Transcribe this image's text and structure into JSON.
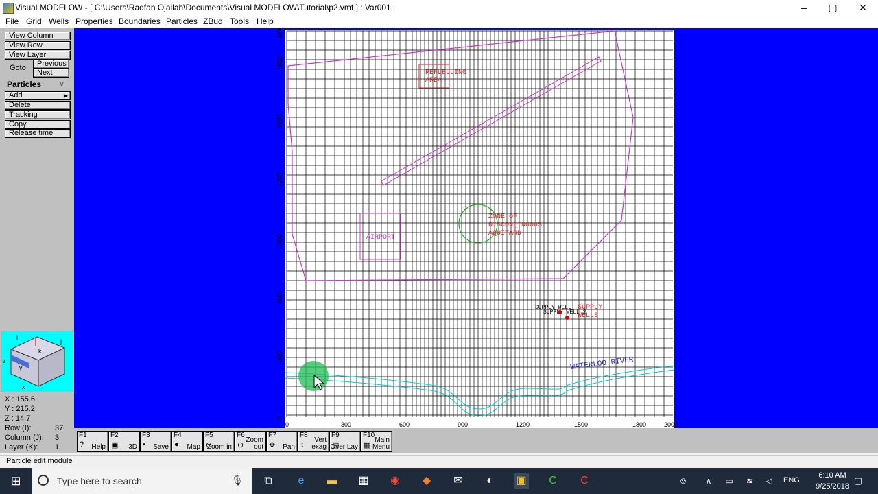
{
  "window": {
    "title": "Visual MODFLOW - [ C:\\Users\\Radfan Ojailah\\Documents\\Visual MODFLOW\\Tutorial\\p2.vmf ] : Var001",
    "minimize": "–",
    "restore": "▢",
    "close": "✕"
  },
  "menu": [
    "File",
    "Grid",
    "Wells",
    "Properties",
    "Boundaries",
    "Particles",
    "ZBud",
    "Tools",
    "Help"
  ],
  "left_panel": {
    "view_column": "View Column",
    "view_row": "View Row",
    "view_layer": "View Layer",
    "goto": "Goto",
    "previous": "Previous",
    "next": "Next",
    "section": "Particles",
    "section_chevron": "∨",
    "add": "Add",
    "add_arrow": "▶",
    "delete": "Delete",
    "tracking": "Tracking",
    "copy": "Copy",
    "release_time": "Release time",
    "cube_axes": {
      "i": "i",
      "j": "j",
      "k": "k",
      "z": "z",
      "y": "y",
      "x": "x"
    }
  },
  "coords": {
    "x_label": "X :",
    "x": "155.6",
    "y_label": "Y :",
    "y": "215.2",
    "z_label": "Z :",
    "z": "14.7",
    "row_label": "Row   (I):",
    "row": "37",
    "col_label": "Column (J):",
    "col": "3",
    "layer_label": "Layer  (K):",
    "layer": "1"
  },
  "map": {
    "x_ticks": [
      "0",
      "300",
      "600",
      "900",
      "1200",
      "1500",
      "1800",
      "2000"
    ],
    "y_ticks": [
      "0",
      "300",
      "600",
      "900",
      "1200",
      "1500",
      "1800",
      "2000"
    ],
    "labels": {
      "refuelling_1": "REFUELLING",
      "refuelling_2": "AREA",
      "zone_1": "ZONE OF",
      "zone_2": "DISCONTINUOUS",
      "zone_3": "AQUITARD",
      "airport": "AIRPORT",
      "supply_well_1": "SUPPLY WELL",
      "supply_well_2": "SUPPLY WELL 2",
      "supply_1": "SUPPLY",
      "supply_2": "WELLS",
      "river": "WATERLOO RIVER"
    },
    "colors": {
      "background": "#0000ff",
      "grid": "#000000",
      "boundary": "#cc33cc",
      "labels": "#dd2222",
      "zone": "#22aa22",
      "river": "#00cccc",
      "river_label": "#2222cc"
    }
  },
  "fkeys": [
    {
      "key": "F1",
      "label": "Help",
      "icon": "question-icon",
      "glyph": "?"
    },
    {
      "key": "F2",
      "label": "3D",
      "icon": "3d-icon",
      "glyph": "▣"
    },
    {
      "key": "F3",
      "label": "Save",
      "icon": "floppy-icon",
      "glyph": "▪"
    },
    {
      "key": "F4",
      "label": "Map",
      "icon": "globe-icon",
      "glyph": "●"
    },
    {
      "key": "F5",
      "label": "Zoom in",
      "icon": "zoom-in-icon",
      "glyph": "⊕"
    },
    {
      "key": "F6",
      "label": "Zoom out",
      "icon": "zoom-out-icon",
      "glyph": "⊖"
    },
    {
      "key": "F7",
      "label": "Pan",
      "icon": "pan-icon",
      "glyph": "✥"
    },
    {
      "key": "F8",
      "label": "Vert exag",
      "icon": "vert-exag-icon",
      "glyph": "↕"
    },
    {
      "key": "F9",
      "label": "Over Lay",
      "icon": "overlay-icon",
      "glyph": "▤"
    },
    {
      "key": "F10",
      "label": "Main Menu",
      "icon": "main-menu-icon",
      "glyph": "▦"
    }
  ],
  "status": "Particle edit module",
  "taskbar": {
    "search_placeholder": "Type here to search",
    "lang": "ENG",
    "time": "6:10 AM",
    "date": "9/25/2018"
  }
}
